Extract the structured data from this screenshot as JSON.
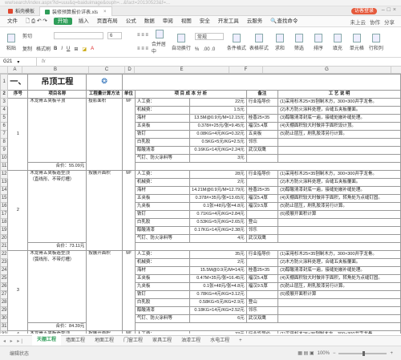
{
  "browser": {
    "url": "ww/search/index.aspx?id=uuu&q=baiduimage&ouph=...&fact=20130523&f=...",
    "tabs": [
      {
        "label": "稻壳模板",
        "color": "#e0462e"
      },
      {
        "label": "装修预算报价详表.xls",
        "color": "#2f9e59"
      }
    ],
    "login": "访客登录"
  },
  "menu": {
    "file": "文件",
    "items": [
      "开始",
      "插入",
      "页面布局",
      "公式",
      "数据",
      "审阅",
      "视图",
      "安全",
      "开发工具",
      "云服务"
    ],
    "search": "查找命令",
    "right": [
      "未上云",
      "协作",
      "分享"
    ]
  },
  "toolbar": {
    "paste": "粘贴",
    "cut": "剪切",
    "copy": "复制",
    "format_painter": "格式刷",
    "font_size": "6",
    "bold": "B",
    "italic": "I",
    "underline": "U",
    "merge": "合并居中",
    "wrap": "自动换行",
    "number_format": "常规",
    "percent": "%",
    "conditional": "条件格式",
    "table_style": "表格样式",
    "sum": "求和",
    "filter": "筛选",
    "sort": "排序",
    "fill": "填充",
    "cell": "单元格",
    "row_col": "行和列"
  },
  "formula_bar": {
    "name_box": "G21",
    "fx": "fx",
    "value": ""
  },
  "columns": [
    "A",
    "B",
    "C",
    "D",
    "E",
    "F",
    "G"
  ],
  "sheet": {
    "section_no": "一、",
    "section_name": "吊顶工程",
    "headers": {
      "no": "序号",
      "name": "项目名称",
      "method": "工程量计算方法",
      "unit": "单位",
      "detail": "项 目 成 本 分 析",
      "note": "备注",
      "desc": "工 艺 说 明"
    },
    "items": [
      {
        "no": "1",
        "name": "木龙骨五夹板平顶",
        "name2": "",
        "method": "投影面积",
        "unit": "M²",
        "details": [
          "人工费：|22元",
          "机械费：|1.5元",
          "海材|13.5M@0.9元/M=12.15元",
          "五夹板|0.378#×25元/张=9.45元",
          "铁钉|0.08KG×4元/KG=0.32元",
          "白乳胶|0.5KG×5元/KG=2.5元",
          "醇酸清漆|0.16KG×14元/KG=2.24元",
          "气钉、防火涂料等|3元"
        ],
        "notes": [
          "行业指导价",
          "",
          "桂香25×35",
          "福汉5.4厚",
          "五夹板",
          "邻乐",
          "武汉双鹰",
          ""
        ],
        "desc": [
          "(1)采用杉木25×35刨制木方，300×300井字龙骨。",
          "(2)木方防火涂料处理，合缝五夹板覆面。",
          "(3)醇酸清漆封底一遍，接缝处嵌补缝处理。",
          "(4)天棚面积较大时做井字面积设计顶。",
          "(5)防止层压，刷乳胶漆另行计算。",
          ""
        ],
        "total": "合价：55.09元",
        "subtotal_row": "9"
      },
      {
        "no": "2",
        "name": "木龙骨五夹板造型顶",
        "name2": "（直线形、不带灯槽）",
        "method": "按展开面积",
        "unit": "M²",
        "details": [
          "人工费：|28元",
          "机械费：|2元",
          "海材|14.21M@0.9元/M=12.79元",
          "五夹板|0.378#×35元/张=13.65元",
          "九夹板|0.1张×48元/张=4.8元",
          "铁钉|0.71KG×4元/KG=2.84元",
          "白乳胶|0.53KG×5元/KG=2.65元",
          "醇酸清漆|0.17KG×14元/KG=2.38元",
          "气钉、防火涂料等|4元"
        ],
        "notes": [
          "行业指导价",
          "",
          "桂香25×35",
          "福汉5.4厚",
          "福汉9.5厚",
          "",
          "登山",
          "邻乐",
          "武汉双鹰"
        ],
        "desc": [
          "(1)采用杉木25×35刨制木方，300×300井字龙骨。",
          "(2)木方防火涂料处理，合缝五夹板覆面。",
          "(3)醇酸清漆封底一遍，接缝处嵌补缝处理。",
          "(4)天棚面积较大时做井字面积，转角处为点缝钉固。",
          "(5)防止层压，刷乳胶漆另行计算。",
          "(6)按展开面积计算"
        ],
        "total": "合价：73.11元"
      },
      {
        "no": "3",
        "name": "木龙骨五夹板造型顶",
        "name2": "（弧线形、不带灯槽）",
        "method": "按展开面积",
        "unit": "M²",
        "details": [
          "人工费：|35元",
          "机械费：|2元",
          "海材|15.5M@0.9元/M=14元",
          "五夹板|0.47M×35元/张=16.45元",
          "九夹板|0.1张×48元/张=4.8元",
          "铁钉|0.78KG×4元/KG=3.12元",
          "白乳胶|0.58KG×5元/KG=2.9元",
          "醇酸清漆|0.18KG×14元/KG=2.52元",
          "气钉、防火涂料等|6元"
        ],
        "notes": [
          "行业指导价",
          "",
          "桂香25×35",
          "福汉5.4厚",
          "福汉9.5厚",
          "",
          "登山",
          "邻乐",
          "武汉双鹰"
        ],
        "desc": [
          "(1)采用杉木25×35刨制木方，300×300井字龙骨。",
          "(2)木方防火涂料处理，合缝五夹板覆面。",
          "(3)醇酸清漆封底一遍，接缝处嵌补缝处理。",
          "(4)天棚面积较大时做井字面积，转角处为点缝钉固。",
          "(5)防止层压，刷乳胶漆另行计算。",
          "(6)按展开面积计算"
        ],
        "total": "合价：84.39元"
      },
      {
        "no": "4",
        "name": "木龙骨五夹板造型顶",
        "name2": "",
        "method": "按展开面积",
        "unit": "M²",
        "details": [
          "人工费：|33元"
        ],
        "notes": [
          "行业指导价"
        ],
        "desc": [
          "(1)采用杉木25×35刨制木方，300×300井字龙骨。"
        ],
        "total": ""
      }
    ]
  },
  "sheet_tabs": [
    "天棚工程",
    "墙面工程",
    "地面工程",
    "门窗工程",
    "家具工程",
    "油漆工程",
    "水电工程"
  ],
  "status": {
    "left": "编辑状态",
    "zoom": "100%"
  }
}
